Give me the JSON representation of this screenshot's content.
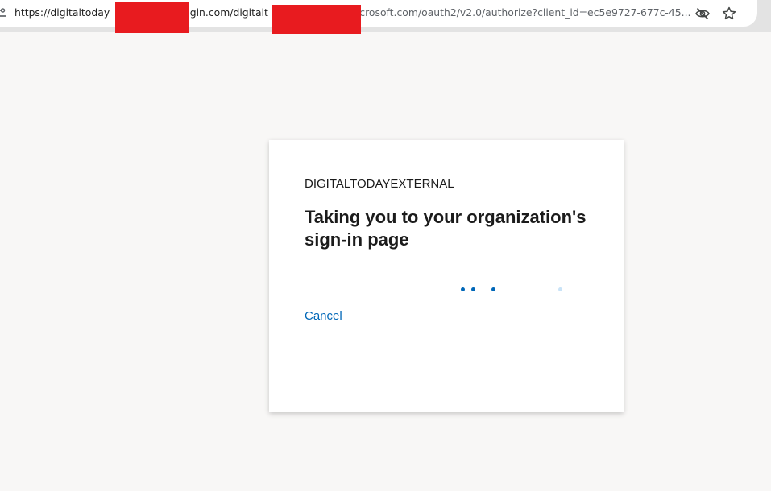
{
  "browser": {
    "url": {
      "host_visible": "https://digitaltoday",
      "middle_visible": "ogin.com/digitalt",
      "tail_visible": "icrosoft.com/oauth2/v2.0/authorize?client_id=ec5e9727-677c-45..."
    },
    "icons": {
      "site_info": "tune-icon",
      "tracking": "eye-off-icon",
      "bookmark": "star-icon"
    },
    "colors": {
      "toolbar": "#e3e3e3",
      "omnibox": "#ffffff",
      "redaction": "#e81b1f"
    }
  },
  "page": {
    "background": "#f8f7f6",
    "organization": "DIGITALTODAYEXTERNAL",
    "title": "Taking you to your organization's sign-in page",
    "progress_dots": [
      {
        "color": "#0067b8"
      },
      {
        "color": "#0067b8"
      },
      {
        "color": "#0067b8"
      },
      {
        "color": "#c9e3f7"
      }
    ],
    "cancel_label": "Cancel",
    "colors": {
      "link": "#0067b8",
      "text": "#1b1b1b",
      "card": "#ffffff"
    }
  }
}
